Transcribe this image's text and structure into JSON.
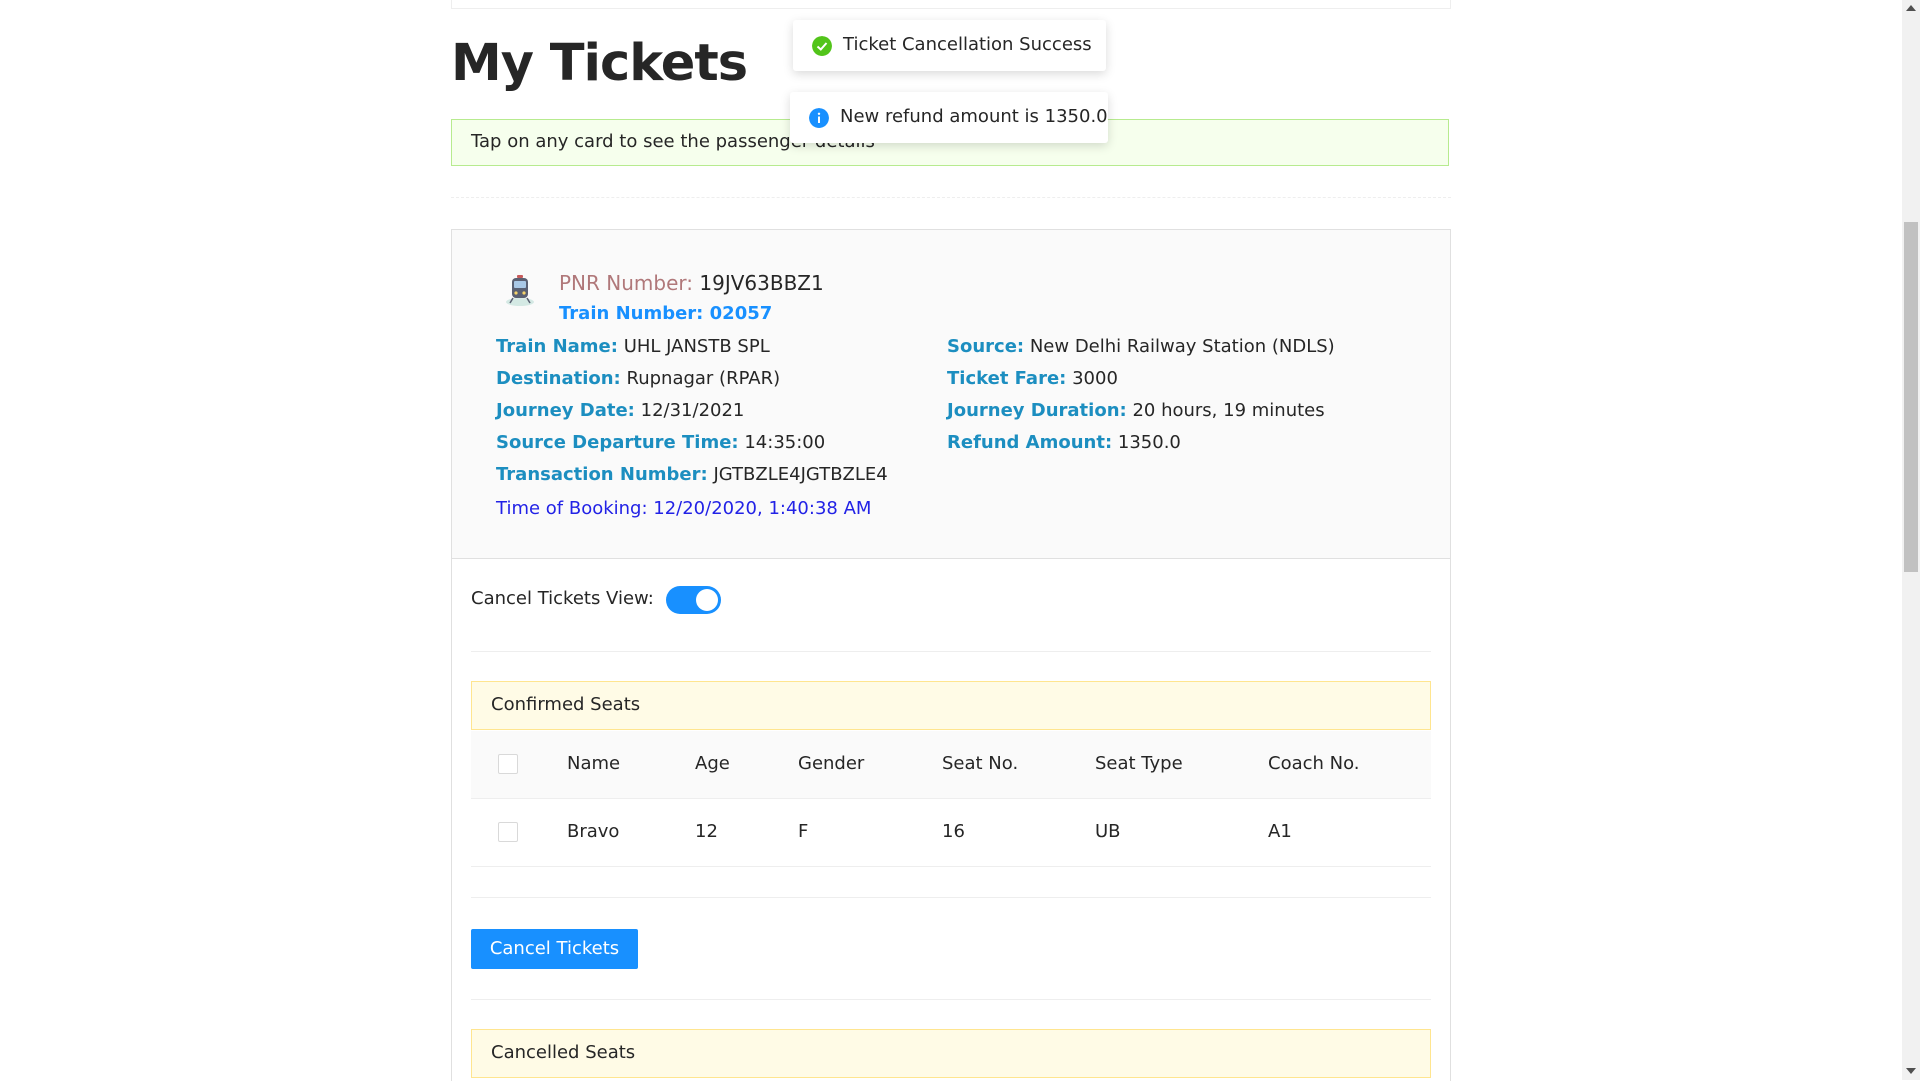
{
  "page": {
    "title": "My Tickets",
    "hint": "Tap on any card to see the passenger details"
  },
  "toasts": [
    {
      "type": "success",
      "icon": "check-circle-icon",
      "color": "#52c41a",
      "text": "Ticket Cancellation Success"
    },
    {
      "type": "info",
      "icon": "info-circle-icon",
      "color": "#1890ff",
      "text": "New refund amount is 1350.0"
    }
  ],
  "ticket": {
    "pnr_label": "PNR Number:",
    "pnr_value": "19JV63BBZ1",
    "train_number": "Train Number: 02057",
    "left_fields": [
      {
        "label": "Train Name:",
        "value": "UHL JANSTB SPL"
      },
      {
        "label": "Destination:",
        "value": "Rupnagar (RPAR)"
      },
      {
        "label": "Journey Date:",
        "value": "12/31/2021"
      },
      {
        "label": "Source Departure Time:",
        "value": "14:35:00"
      },
      {
        "label": "Transaction Number:",
        "value": "JGTBZLE4JGTBZLE4"
      }
    ],
    "right_fields": [
      {
        "label": "Source:",
        "value": "New Delhi Railway Station (NDLS)"
      },
      {
        "label": "Ticket Fare:",
        "value": "3000"
      },
      {
        "label": "Journey Duration:",
        "value": "20 hours, 19 minutes"
      },
      {
        "label": "Refund Amount:",
        "value": "1350.0"
      }
    ],
    "time_of_booking": "Time of Booking: 12/20/2020, 1:40:38 AM"
  },
  "cancel_view": {
    "label": "Cancel Tickets View:",
    "enabled": true
  },
  "confirmed": {
    "title": "Confirmed Seats",
    "columns": [
      "Name",
      "Age",
      "Gender",
      "Seat No.",
      "Seat Type",
      "Coach No."
    ],
    "rows": [
      [
        "Bravo",
        "12",
        "F",
        "16",
        "UB",
        "A1"
      ]
    ]
  },
  "cancel_button": "Cancel Tickets",
  "cancelled": {
    "title": "Cancelled Seats"
  },
  "colors": {
    "primary": "#1890ff",
    "label_teal": "#1c8ec0",
    "pnr_label": "#b0787a",
    "booking_blue": "#2222e6"
  }
}
